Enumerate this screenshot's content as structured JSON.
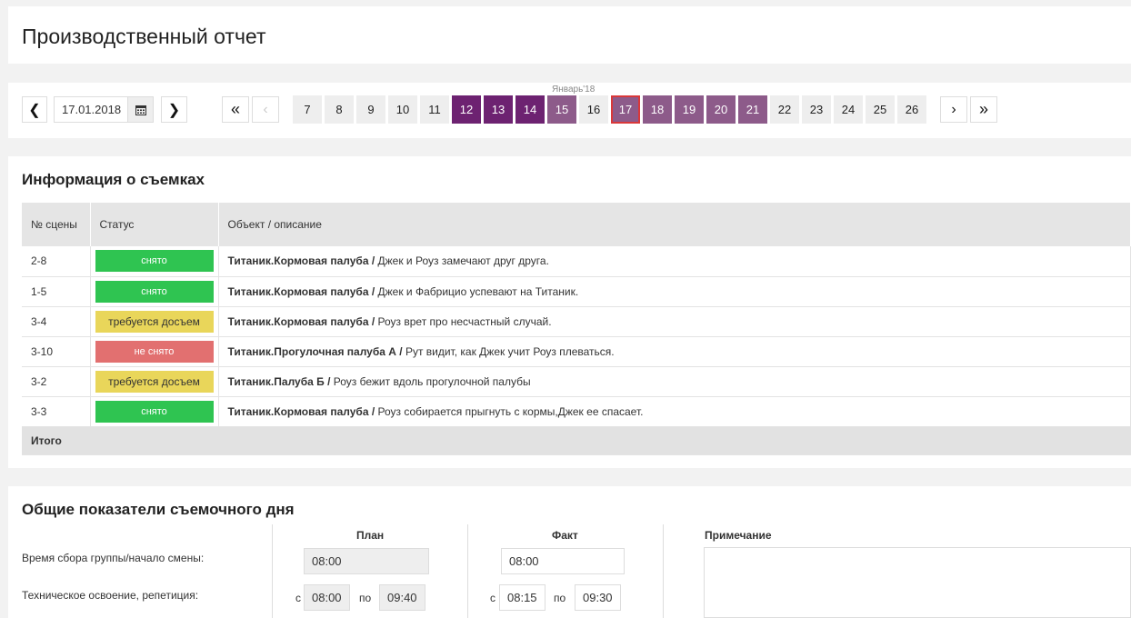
{
  "page_title": "Производственный отчет",
  "nav": {
    "prev_label": "❮",
    "next_label": "❯",
    "date_value": "17.01.2018",
    "first_label": "«",
    "prev_page_label": "‹",
    "next_page_label": "›",
    "last_label": "»",
    "month_label": "Январь'18",
    "days": [
      "7",
      "8",
      "9",
      "10",
      "11",
      "12",
      "13",
      "14",
      "15",
      "16",
      "17",
      "18",
      "19",
      "20",
      "21",
      "22",
      "23",
      "24",
      "25",
      "26"
    ],
    "selected_day": "17"
  },
  "scenes": {
    "heading": "Информация о съемках",
    "columns": [
      "№ сцены",
      "Статус",
      "Объект / описание"
    ],
    "rows": [
      {
        "scene": "2-8",
        "status": "снято",
        "object": "Титаник.Кормовая палуба /",
        "desc": " Джек и Роуз замечают друг друга."
      },
      {
        "scene": "1-5",
        "status": "снято",
        "object": "Титаник.Кормовая палуба /",
        "desc": " Джек и Фабрицио успевают на Титаник."
      },
      {
        "scene": "3-4",
        "status": "требуется досъем",
        "object": "Титаник.Кормовая палуба /",
        "desc": " Роуз врет про несчастный случай."
      },
      {
        "scene": "3-10",
        "status": "не снято",
        "object": "Титаник.Прогулочная палуба А /",
        "desc": " Рут видит, как Джек учит Роуз плеваться."
      },
      {
        "scene": "3-2",
        "status": "требуется досъем",
        "object": "Титаник.Палуба Б /",
        "desc": " Роуз бежит вдоль прогулочной палубы"
      },
      {
        "scene": "3-3",
        "status": "снято",
        "object": "Титаник.Кормовая палуба /",
        "desc": " Роуз собирается прыгнуть с кормы,Джек ее спасает."
      }
    ],
    "total_label": "Итого",
    "status_colors": {
      "снято": "#2fc451",
      "требуется досъем": "#e9d65a",
      "не снято": "#e27070"
    }
  },
  "day": {
    "heading": "Общие показатели съемочного дня",
    "plan_label": "План",
    "fact_label": "Факт",
    "note_label": "Примечание",
    "row1_label": "Время сбора группы/начало смены:",
    "row2_label": "Техническое освоение, репетиция:",
    "plan_start": "08:00",
    "fact_start": "08:00",
    "from_label": "с",
    "to_label": "по",
    "plan_from": "08:00",
    "plan_to": "09:40",
    "fact_from": "08:15",
    "fact_to": "09:30"
  },
  "colors": {
    "accent_dark": "#6d2271",
    "accent_light": "#8d5b8a",
    "selected_border": "#d9383a"
  }
}
